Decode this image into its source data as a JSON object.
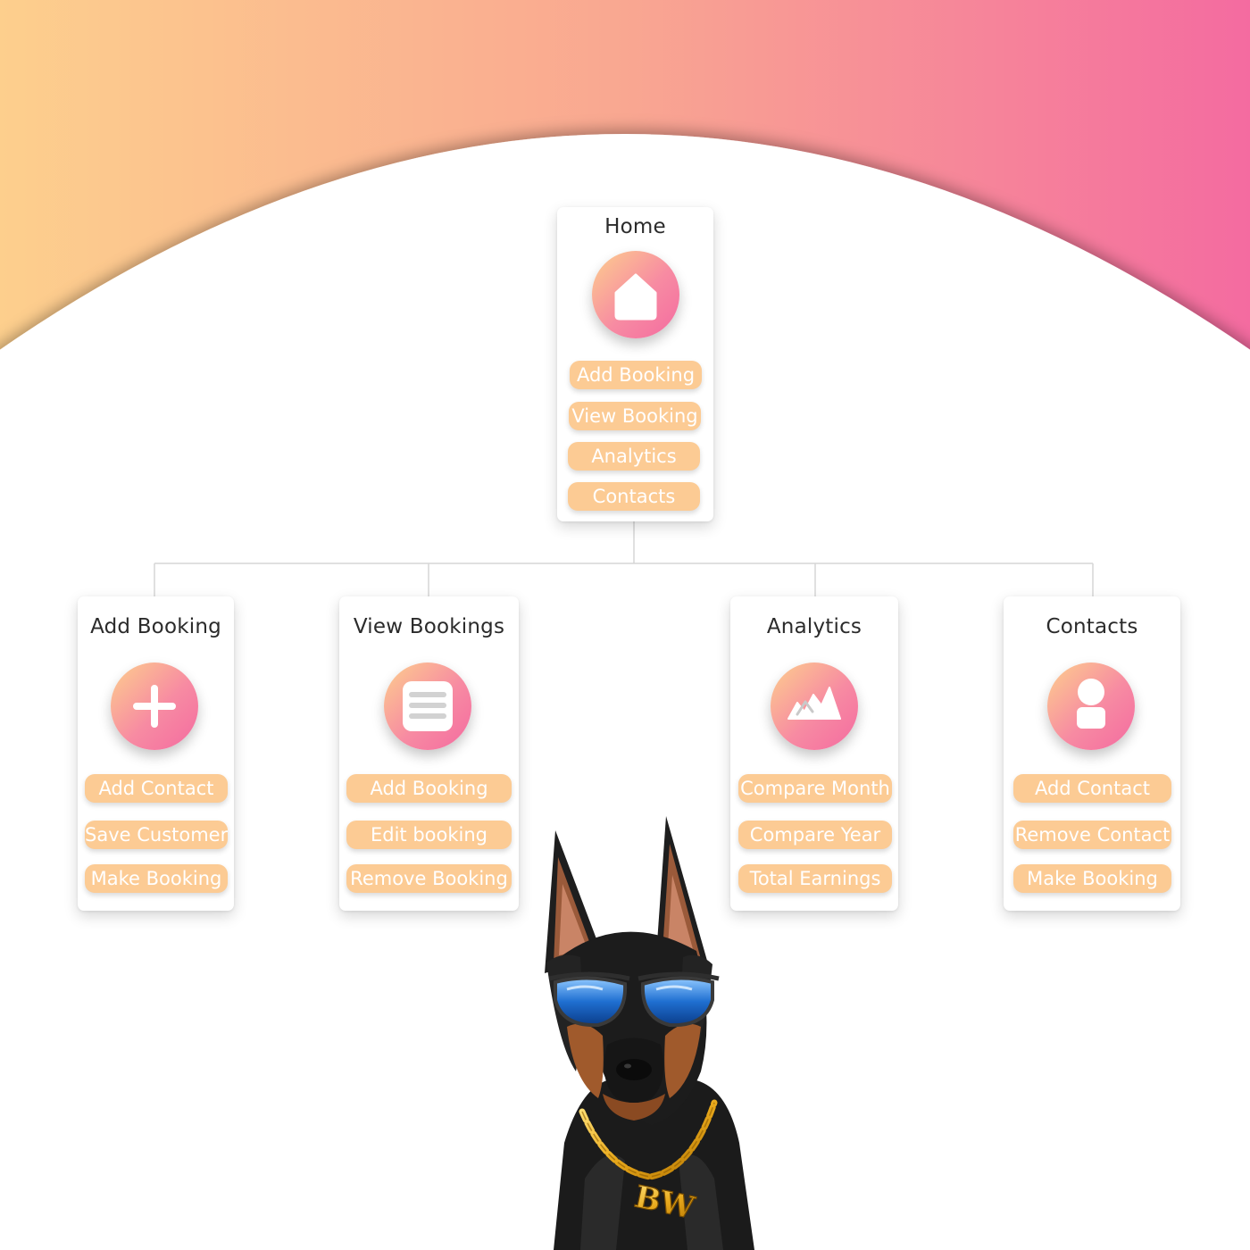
{
  "home": {
    "title": "Home",
    "items": [
      "Add Booking",
      "View Booking",
      "Analytics",
      "Contacts"
    ]
  },
  "nodes": [
    {
      "title": "Add Booking",
      "icon": "plus-icon",
      "items": [
        "Add Contact",
        "Save Customer",
        "Make Booking"
      ]
    },
    {
      "title": "View Bookings",
      "icon": "document-icon",
      "items": [
        "Add Booking",
        "Edit booking",
        "Remove Booking"
      ]
    },
    {
      "title": "Analytics",
      "icon": "chart-icon",
      "items": [
        "Compare Month",
        "Compare Year",
        "Total Earnings"
      ]
    },
    {
      "title": "Contacts",
      "icon": "person-icon",
      "items": [
        "Add Contact",
        "Remove Contact",
        "Make Booking"
      ]
    }
  ],
  "mascot": {
    "pendant_text": "BW"
  },
  "colors": {
    "gradient_start": "#fdcf8d",
    "gradient_end": "#f46ba0",
    "pill": "#fccb94",
    "connector": "#d6d6d6"
  }
}
